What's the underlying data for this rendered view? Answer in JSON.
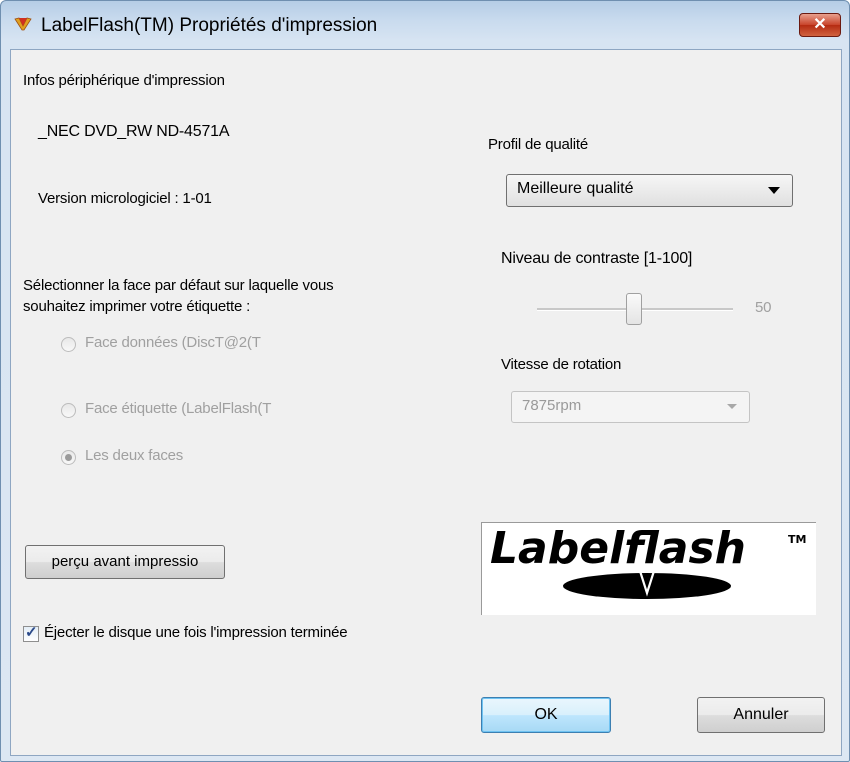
{
  "window": {
    "title": "LabelFlash(TM) Propriétés d'impression",
    "close_glyph": "✕",
    "icon": "labelflash-app-icon"
  },
  "device": {
    "section_label": "Infos périphérique d'impression",
    "name": "_NEC DVD_RW ND-4571A",
    "firmware": "Version micrologiciel : 1-01"
  },
  "face": {
    "prompt_line1": "Sélectionner la face par défaut sur laquelle vous",
    "prompt_line2": "souhaitez imprimer votre étiquette :",
    "options": [
      {
        "label": "Face données (DiscT@2(T",
        "checked": false
      },
      {
        "label": "Face étiquette (LabelFlash(T",
        "checked": false
      },
      {
        "label": "Les deux faces",
        "checked": true
      }
    ]
  },
  "preview_button": "perçu avant impressio",
  "eject": {
    "label": "Éjecter le disque une fois l'impression terminée",
    "checked": true
  },
  "quality": {
    "label": "Profil de qualité",
    "selected": "Meilleure qualité"
  },
  "contrast": {
    "label": "Niveau de contraste [1-100]",
    "value": "50",
    "level": 50
  },
  "rotation": {
    "label": "Vitesse de rotation",
    "selected": "7875rpm"
  },
  "logo": {
    "text": "Labelflash",
    "tm": "TM"
  },
  "buttons": {
    "ok": "OK",
    "cancel": "Annuler"
  },
  "colors": {
    "title_bar": "#c9dbee",
    "client_bg": "#f0f0f0",
    "close_red": "#c8432a",
    "disabled_text": "#a0a0a0"
  }
}
